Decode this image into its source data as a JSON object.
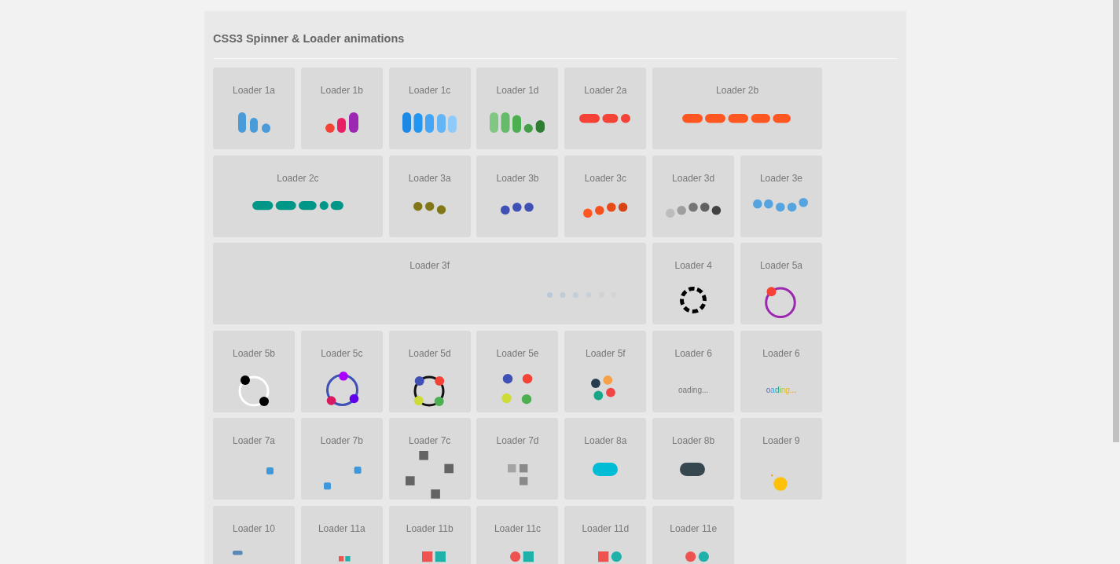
{
  "title": "CSS3 Spinner & Loader animations",
  "loaders": [
    {
      "label": "Loader 1a",
      "kind": "bars"
    },
    {
      "label": "Loader 1b",
      "kind": "bars"
    },
    {
      "label": "Loader 1c",
      "kind": "bars"
    },
    {
      "label": "Loader 1d",
      "kind": "bars"
    },
    {
      "label": "Loader 2a",
      "kind": "pills"
    },
    {
      "label": "Loader 2b",
      "kind": "pills"
    },
    {
      "label": "Loader 2c",
      "kind": "pills"
    },
    {
      "label": "Loader 3a",
      "kind": "dots"
    },
    {
      "label": "Loader 3b",
      "kind": "dots"
    },
    {
      "label": "Loader 3c",
      "kind": "dots"
    },
    {
      "label": "Loader 3d",
      "kind": "dots"
    },
    {
      "label": "Loader 3e",
      "kind": "dots"
    },
    {
      "label": "Loader 3f",
      "kind": "fade"
    },
    {
      "label": "Loader 4",
      "kind": "dashring"
    },
    {
      "label": "Loader 5a",
      "kind": "orbit"
    },
    {
      "label": "Loader 5b",
      "kind": "orbit"
    },
    {
      "label": "Loader 5c",
      "kind": "orbit"
    },
    {
      "label": "Loader 5d",
      "kind": "orbit"
    },
    {
      "label": "Loader 5e",
      "kind": "cluster"
    },
    {
      "label": "Loader 5f",
      "kind": "cluster"
    },
    {
      "label": "Loader 6",
      "kind": "text",
      "text": "oading...",
      "rainbow": false
    },
    {
      "label": "Loader 6",
      "kind": "text",
      "text": "oading...",
      "rainbow": true
    },
    {
      "label": "Loader 7a",
      "kind": "squares"
    },
    {
      "label": "Loader 7b",
      "kind": "squares"
    },
    {
      "label": "Loader 7c",
      "kind": "squares"
    },
    {
      "label": "Loader 7d",
      "kind": "squares"
    },
    {
      "label": "Loader 8a",
      "kind": "capsule"
    },
    {
      "label": "Loader 8b",
      "kind": "capsule"
    },
    {
      "label": "Loader 9",
      "kind": "ball"
    },
    {
      "label": "Loader 10",
      "kind": "dash"
    },
    {
      "label": "Loader 11a",
      "kind": "shapes"
    },
    {
      "label": "Loader 11b",
      "kind": "shapes"
    },
    {
      "label": "Loader 11c",
      "kind": "shapes"
    },
    {
      "label": "Loader 11d",
      "kind": "shapes"
    },
    {
      "label": "Loader 11e",
      "kind": "shapes"
    }
  ]
}
